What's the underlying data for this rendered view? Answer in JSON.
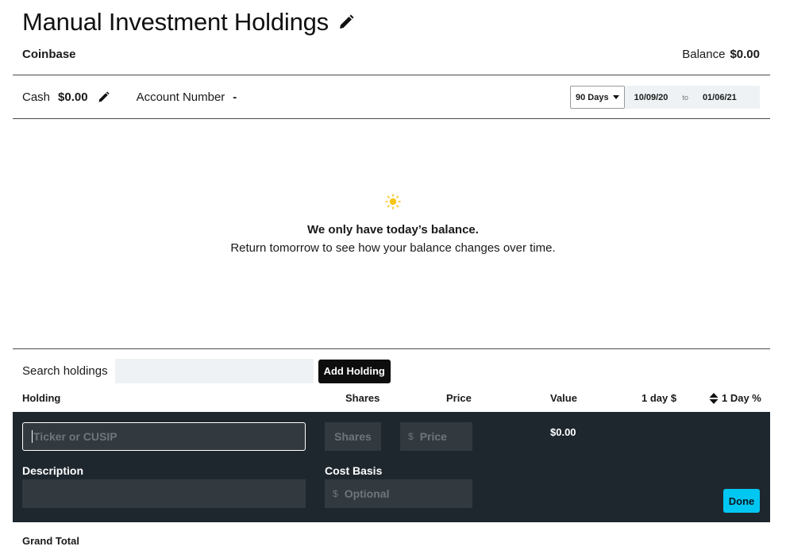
{
  "header": {
    "title": "Manual Investment Holdings",
    "edit_icon": "pencil-icon"
  },
  "account": {
    "name": "Coinbase",
    "balance_label": "Balance",
    "balance_value": "$0.00"
  },
  "summary": {
    "cash_label": "Cash",
    "cash_value": "$0.00",
    "account_number_label": "Account Number",
    "account_number_value": "-",
    "range_option": "90 Days",
    "date_from": "10/09/20",
    "date_to_sep": "to",
    "date_to": "01/06/21"
  },
  "empty_state": {
    "icon": "sun-icon",
    "title": "We only have today’s balance.",
    "subtitle": "Return tomorrow to see how your balance changes over time."
  },
  "holdings": {
    "search_label": "Search holdings",
    "search_value": "",
    "add_button": "Add Holding",
    "columns": {
      "holding": "Holding",
      "shares": "Shares",
      "price": "Price",
      "value": "Value",
      "one_day_dollar": "1 day $",
      "one_day_pct": "1 Day %"
    },
    "editor": {
      "ticker_placeholder": "Ticker or CUSIP",
      "shares_placeholder": "Shares",
      "price_currency": "$",
      "price_placeholder": "Price",
      "value": "$0.00",
      "description_label": "Description",
      "description_value": "",
      "cost_basis_label": "Cost Basis",
      "cost_currency": "$",
      "cost_placeholder": "Optional",
      "done_button": "Done"
    },
    "grand_total_label": "Grand Total"
  },
  "colors": {
    "panel_bg": "#1f272e",
    "field_bg": "#323a40",
    "accent": "#00c7f2",
    "sun": "#f5c518"
  }
}
